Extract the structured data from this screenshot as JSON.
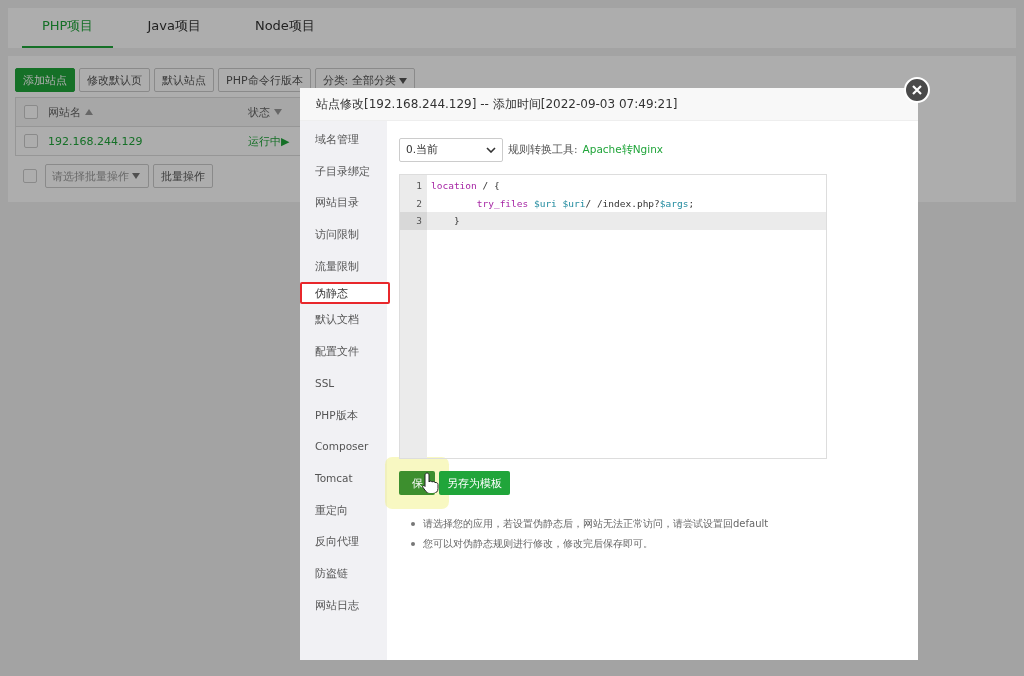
{
  "tabs": [
    {
      "label": "PHP项目",
      "selected": true
    },
    {
      "label": "Java项目",
      "selected": false
    },
    {
      "label": "Node项目",
      "selected": false
    }
  ],
  "toolbar": {
    "buttons": [
      {
        "label": "添加站点",
        "kind": "primary"
      },
      {
        "label": "修改默认页",
        "kind": "plain"
      },
      {
        "label": "默认站点",
        "kind": "plain"
      },
      {
        "label": "PHP命令行版本",
        "kind": "plain"
      }
    ],
    "category": "分类: 全部分类"
  },
  "table": {
    "select_all_checked": false,
    "columns": [
      {
        "label": "网站名"
      },
      {
        "label": "状态"
      }
    ],
    "rows": [
      {
        "name": "192.168.244.129",
        "status": "运行中▶",
        "checked": false
      }
    ]
  },
  "batch": {
    "checked": false,
    "placeholder": "请选择批量操作",
    "button": "批量操作"
  },
  "dialog": {
    "title": "站点修改[192.168.244.129] -- 添加时间[2022-09-03 07:49:21]",
    "menu": [
      {
        "label": "域名管理",
        "selected": false
      },
      {
        "label": "子目录绑定",
        "selected": false
      },
      {
        "label": "网站目录",
        "selected": false
      },
      {
        "label": "访问限制",
        "selected": false
      },
      {
        "label": "流量限制",
        "selected": false
      },
      {
        "label": "伪静态",
        "selected": true
      },
      {
        "label": "默认文档",
        "selected": false
      },
      {
        "label": "配置文件",
        "selected": false
      },
      {
        "label": "SSL",
        "selected": false
      },
      {
        "label": "PHP版本",
        "selected": false
      },
      {
        "label": "Composer",
        "selected": false
      },
      {
        "label": "Tomcat",
        "selected": false
      },
      {
        "label": "重定向",
        "selected": false
      },
      {
        "label": "反向代理",
        "selected": false
      },
      {
        "label": "防盗链",
        "selected": false
      },
      {
        "label": "网站日志",
        "selected": false
      }
    ],
    "template_select": "0.当前",
    "tool_label": "规则转换工具:",
    "tool_link": "Apache转Nginx",
    "code": [
      {
        "number": "1",
        "active": false,
        "tokens": [
          {
            "text": "location",
            "kind": "keyword"
          },
          {
            "text": " / {",
            "kind": "plain"
          }
        ]
      },
      {
        "number": "2",
        "active": false,
        "tokens": [
          {
            "text": "        try_files",
            "kind": "keyword"
          },
          {
            "text": " $uri",
            "kind": "variable"
          },
          {
            "text": " $uri",
            "kind": "variable"
          },
          {
            "text": "/ /index.php?",
            "kind": "plain"
          },
          {
            "text": "$args",
            "kind": "variable"
          },
          {
            "text": ";",
            "kind": "plain"
          }
        ]
      },
      {
        "number": "3",
        "active": true,
        "tokens": [
          {
            "text": "    }",
            "kind": "plain"
          }
        ]
      }
    ],
    "buttons": [
      {
        "label": "保",
        "kind": "save"
      },
      {
        "label": "另存为模板",
        "kind": "template"
      }
    ],
    "notes": [
      "请选择您的应用，若设置伪静态后，网站无法正常访问，请尝试设置回default",
      "您可以对伪静态规则进行修改，修改完后保存即可。"
    ]
  }
}
